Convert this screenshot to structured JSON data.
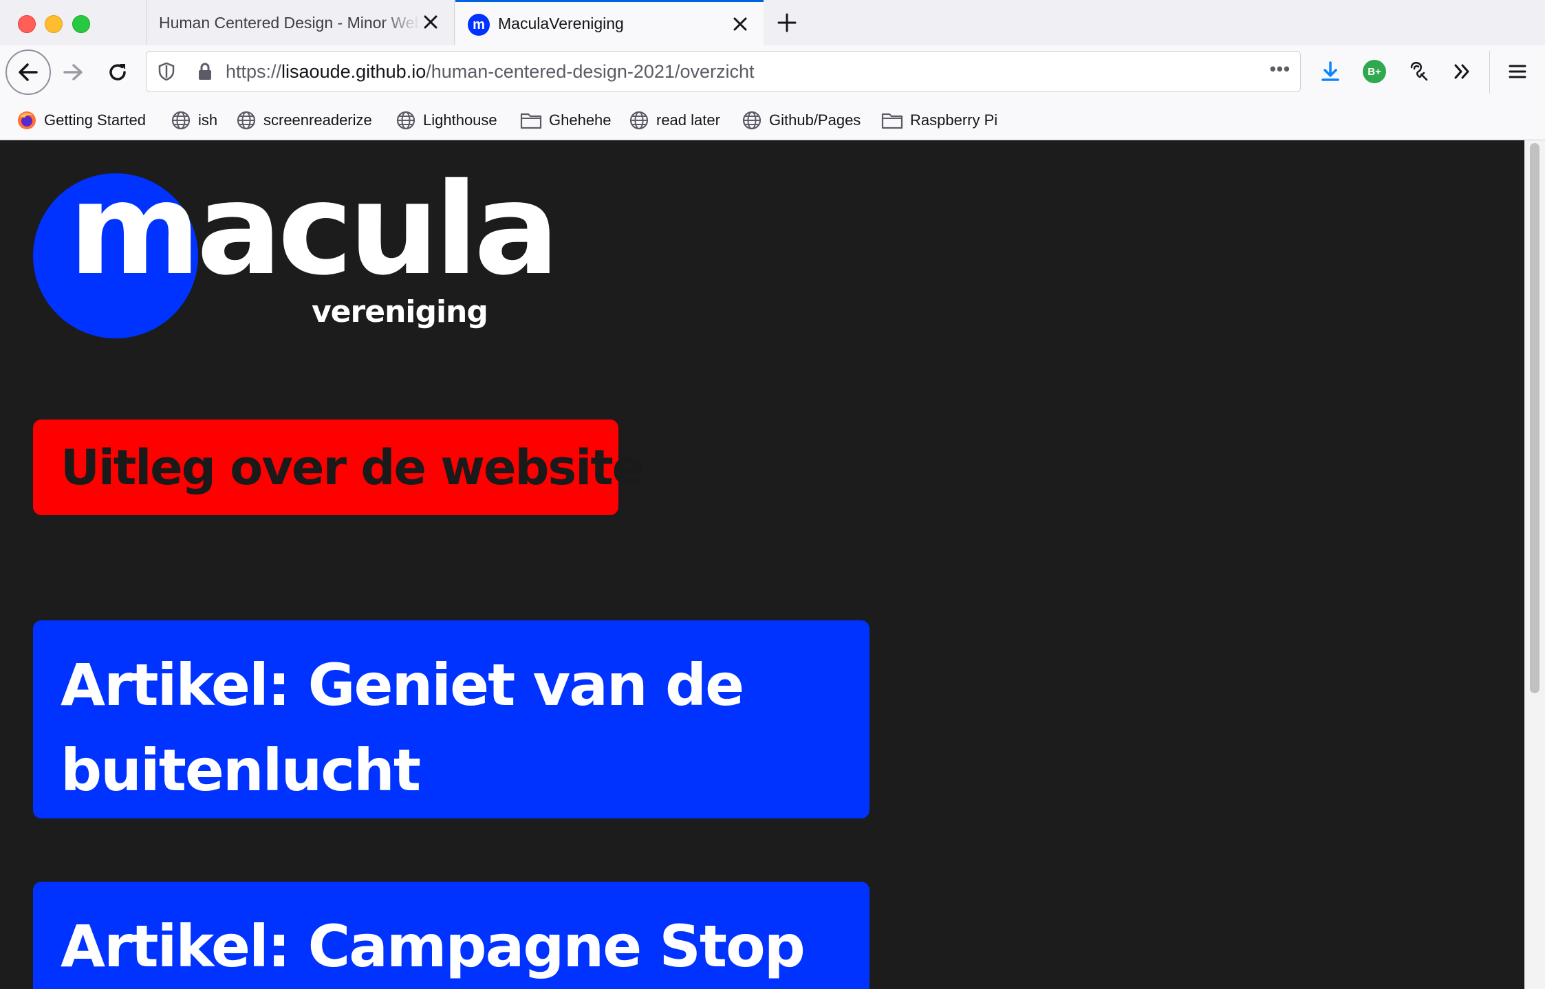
{
  "browser": {
    "tabs": [
      {
        "title": "Human Centered Design - Minor Web Design",
        "active": false
      },
      {
        "title": "MaculaVereniging",
        "active": true,
        "favicon_letter": "m"
      }
    ],
    "url": {
      "scheme": "https://",
      "host": "lisaoude.github.io",
      "path": "/human-centered-design-2021/overzicht"
    },
    "url_menu_label": "•••",
    "bookmarks": [
      {
        "label": "Getting Started",
        "icon": "firefox-icon"
      },
      {
        "label": "ish",
        "icon": "globe-icon"
      },
      {
        "label": "screenreaderize",
        "icon": "globe-icon"
      },
      {
        "label": "Lighthouse",
        "icon": "globe-icon"
      },
      {
        "label": "Ghehehe",
        "icon": "folder-icon"
      },
      {
        "label": "read later",
        "icon": "globe-icon"
      },
      {
        "label": "Github/Pages",
        "icon": "globe-icon"
      },
      {
        "label": "Raspberry Pi",
        "icon": "folder-icon"
      }
    ],
    "extension_badge": "B+",
    "colors": {
      "accent": "#0061e0",
      "download": "#0a84ff"
    }
  },
  "page": {
    "logo": {
      "word": "macula",
      "sub": "vereniging",
      "color": "#0033ff"
    },
    "uitleg_button": "Uitleg over de website",
    "articles": [
      {
        "lines": [
          "Artikel: Geniet van de",
          "buitenlucht"
        ]
      },
      {
        "lines": [
          "Artikel: Campagne Stop"
        ]
      }
    ],
    "colors": {
      "background": "#1c1c1c",
      "button_red": "#ff0000",
      "card_blue": "#0033ff"
    }
  }
}
